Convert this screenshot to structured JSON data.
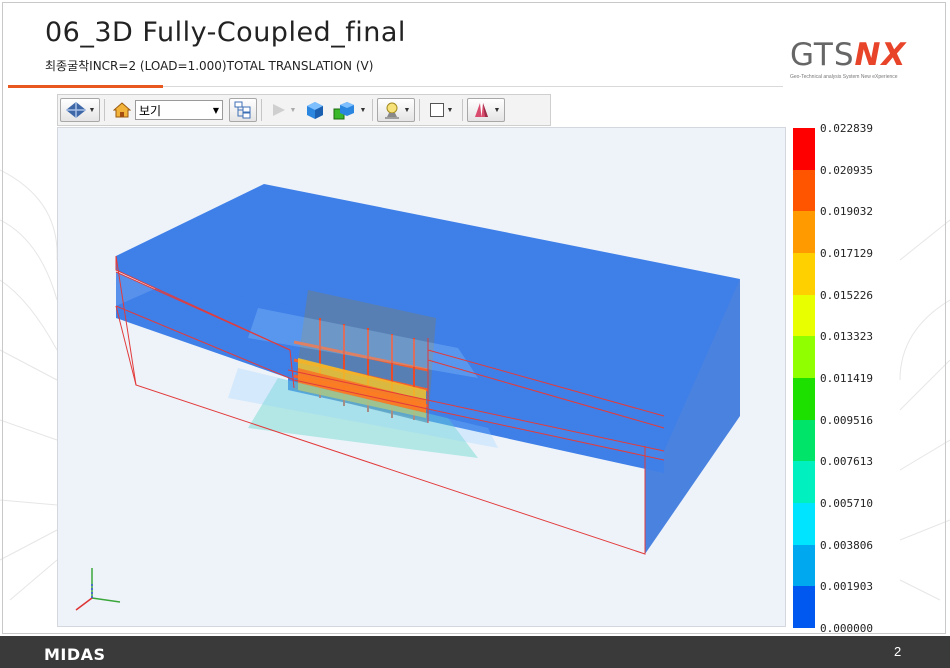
{
  "slide": {
    "title": "06_3D Fully-Coupled_final",
    "subtitle": "최종굴착INCR=2 (LOAD=1.000)TOTAL TRANSLATION (V)",
    "page_number": "2",
    "footer_logo": "MIDAS"
  },
  "logo": {
    "gts": "GTS",
    "nx": "NX",
    "tagline": "Geo-Technical analysis System New eXperience"
  },
  "toolbar": {
    "view_label": "보기",
    "icons": [
      "view-orientation-icon",
      "home-icon",
      "tree-icon",
      "play-icon",
      "solid-box-icon",
      "box-color-icon",
      "light-bulb-icon",
      "frame-square-icon",
      "display-mode-icon"
    ]
  },
  "legend": {
    "values": [
      "0.022839",
      "0.020935",
      "0.019032",
      "0.017129",
      "0.015226",
      "0.013323",
      "0.011419",
      "0.009516",
      "0.007613",
      "0.005710",
      "0.003806",
      "0.001903",
      "0.000000"
    ],
    "colors": [
      "#ff0000",
      "#ff5500",
      "#ff9a00",
      "#ffd000",
      "#e8ff00",
      "#90ff00",
      "#1ee000",
      "#00e46a",
      "#00f0c0",
      "#00e4ff",
      "#00a8f0",
      "#0058f0",
      "#0000ff"
    ]
  },
  "colors": {
    "accent": "#e8571e",
    "model_blue": "#3f7fe8",
    "edge_red": "#e23b3b",
    "footer_bar": "#3a3a3a"
  }
}
